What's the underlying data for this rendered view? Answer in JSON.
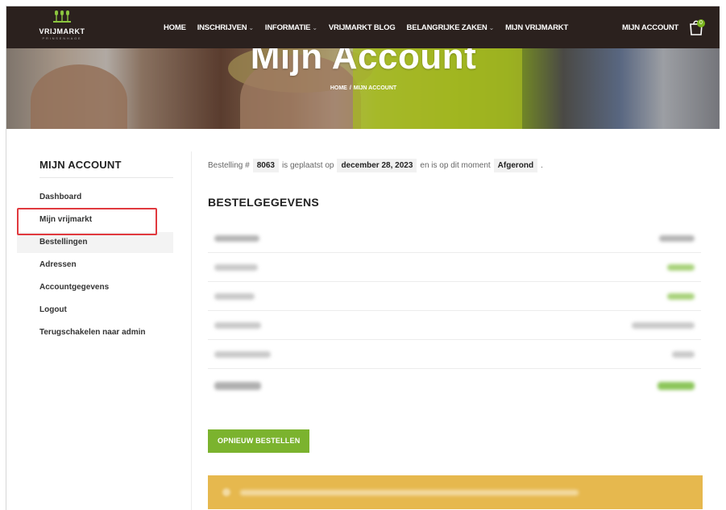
{
  "header": {
    "logo": {
      "name": "VRIJMARKT",
      "sub": "PRINSENHAGE"
    },
    "nav": [
      {
        "label": "HOME",
        "has_dropdown": false
      },
      {
        "label": "INSCHRIJVEN",
        "has_dropdown": true
      },
      {
        "label": "INFORMATIE",
        "has_dropdown": true
      },
      {
        "label": "VRIJMARKT BLOG",
        "has_dropdown": false
      },
      {
        "label": "BELANGRIJKE ZAKEN",
        "has_dropdown": true
      },
      {
        "label": "MIJN VRIJMARKT",
        "has_dropdown": false
      }
    ],
    "account_label": "MIJN ACCOUNT",
    "cart_count": "0"
  },
  "hero": {
    "title": "Mijn Account",
    "breadcrumb": {
      "home": "HOME",
      "separator": "/",
      "current": "MIJN ACCOUNT"
    }
  },
  "sidebar": {
    "title": "MIJN ACCOUNT",
    "items": [
      {
        "label": "Dashboard",
        "active": false
      },
      {
        "label": "Mijn vrijmarkt",
        "active": false,
        "highlighted": true
      },
      {
        "label": "Bestellingen",
        "active": true
      },
      {
        "label": "Adressen",
        "active": false
      },
      {
        "label": "Accountgegevens",
        "active": false
      },
      {
        "label": "Logout",
        "active": false
      },
      {
        "label": "Terugschakelen naar admin",
        "active": false
      }
    ]
  },
  "order": {
    "status_prefix": "Bestelling #",
    "number": "8063",
    "placed_text": "is geplaatst op",
    "date": "december 28, 2023",
    "state_text": "en is op dit moment",
    "state": "Afgerond",
    "suffix": "."
  },
  "details": {
    "title": "BESTELGEGEVENS"
  },
  "actions": {
    "reorder_label": "OPNIEUW BESTELLEN"
  },
  "colors": {
    "header_bg": "#2b211e",
    "accent_green": "#7bb32e",
    "notice_bg": "#e6b84e",
    "highlight_red": "#e0393e"
  }
}
